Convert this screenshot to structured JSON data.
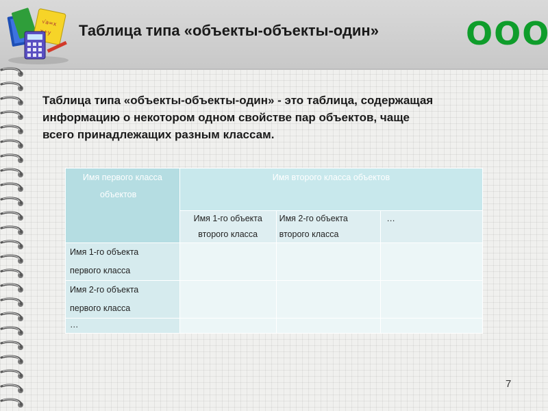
{
  "slide": {
    "title": "Таблица типа «объекты-объекты-один»",
    "badge": "ООО",
    "paragraph_lines": [
      "Таблица типа «объекты-объекты-один» - это таблица, содержащая",
      "информацию о некотором одном свойстве пар объектов, чаще",
      "всего принадлежащих разным классам."
    ],
    "page_number": "7"
  },
  "table": {
    "corner_line1": "Имя первого класса",
    "corner_line2": "объектов",
    "top_header": "Имя второго класса объектов",
    "columns": [
      {
        "line1": "Имя 1-го объекта",
        "line2": "второго класса"
      },
      {
        "line1": "Имя 2-го объекта",
        "line2": "второго класса"
      },
      {
        "line1": "…",
        "line2": ""
      }
    ],
    "rows": [
      {
        "line1": "Имя 1-го объекта",
        "line2": "первого класса"
      },
      {
        "line1": "Имя 2-го объекта",
        "line2": "первого класса"
      },
      {
        "line1": "…",
        "line2": ""
      }
    ]
  },
  "colors": {
    "badge": "#0f9d2b",
    "header_cell": "#b5dde2",
    "empty_cell": "#ecf6f7"
  },
  "icons": [
    "school-supplies-logo-icon",
    "spiral-binding-icon"
  ]
}
